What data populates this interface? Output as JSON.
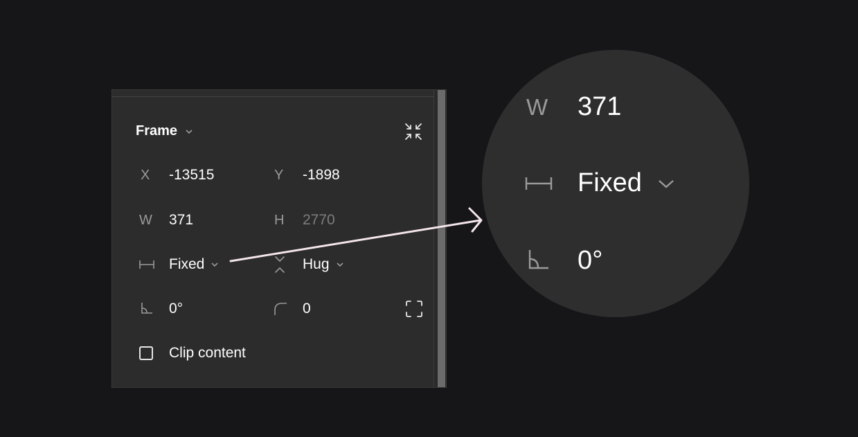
{
  "panel": {
    "title": "Frame",
    "fields": {
      "x": {
        "label": "X",
        "value": "-13515"
      },
      "y": {
        "label": "Y",
        "value": "-1898"
      },
      "w": {
        "label": "W",
        "value": "371"
      },
      "h": {
        "label": "H",
        "value": "2770"
      },
      "width_mode": "Fixed",
      "height_mode": "Hug",
      "rotation": "0°",
      "corner_radius": "0"
    },
    "clip_content_label": "Clip content",
    "clip_content_checked": false
  },
  "zoom": {
    "w_label": "W",
    "w_value": "371",
    "width_mode": "Fixed",
    "rotation": "0°"
  },
  "colors": {
    "background": "#161619",
    "panel": "#2c2c2c",
    "magnifier": "#2e2e2e",
    "arrow": "#f4e6ec",
    "label": "#9a9a9a",
    "muted_value": "#7d7d7d"
  },
  "icons": [
    "chevron-down-icon",
    "collapse-icon",
    "fixed-width-icon",
    "hug-height-icon",
    "rotation-icon",
    "corner-radius-icon",
    "independent-corners-icon",
    "checkbox-icon",
    "arrow-icon"
  ]
}
